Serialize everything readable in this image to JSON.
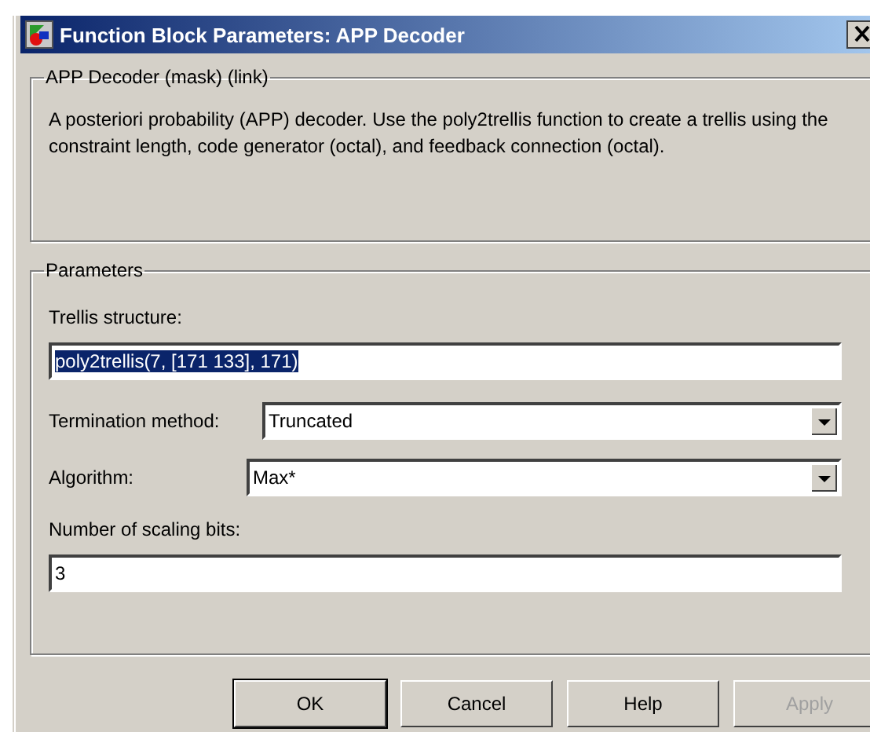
{
  "window": {
    "title": "Function Block Parameters: APP Decoder"
  },
  "description": {
    "legend": "APP Decoder (mask) (link)",
    "text": "A posteriori probability (APP) decoder. Use the poly2trellis function to create a trellis using the constraint length, code generator (octal), and feedback connection (octal)."
  },
  "parameters": {
    "legend": "Parameters",
    "fields": [
      {
        "kind": "text",
        "label": "Trellis structure:",
        "value": "poly2trellis(7, [171 133], 171)",
        "selected": true
      },
      {
        "kind": "dropdown",
        "label": "Termination method:",
        "value": "Truncated",
        "selected": false
      },
      {
        "kind": "dropdown",
        "label": "Algorithm:",
        "value": "Max*",
        "selected": false
      },
      {
        "kind": "text",
        "label": "Number of scaling bits:",
        "value": "3",
        "selected": false
      }
    ]
  },
  "buttons": [
    {
      "label": "OK",
      "default": true,
      "disabled": false
    },
    {
      "label": "Cancel",
      "default": false,
      "disabled": false
    },
    {
      "label": "Help",
      "default": false,
      "disabled": false
    },
    {
      "label": "Apply",
      "default": false,
      "disabled": true
    }
  ]
}
